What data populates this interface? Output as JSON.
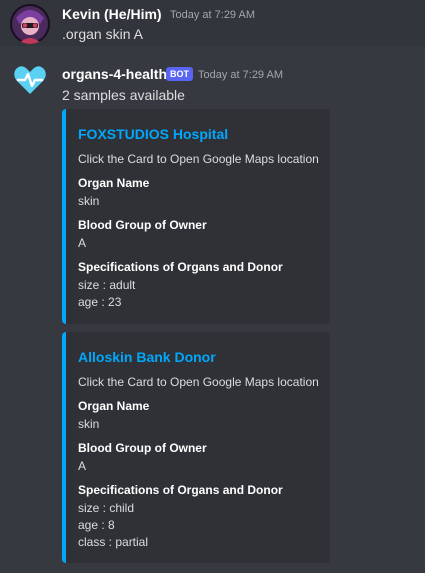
{
  "messages": [
    {
      "author": "Kevin (He/Him)",
      "timestamp": "Today at 7:29 AM",
      "content": ".organ skin A",
      "avatar_icon": "user-avatar-icon"
    },
    {
      "author": "organs-4-health",
      "badge": "BOT",
      "timestamp": "Today at 7:29 AM",
      "content": "2 samples available",
      "avatar_icon": "heart-pulse-icon",
      "embeds": [
        {
          "title": "FOXSTUDIOS Hospital",
          "description": "Click the Card to Open Google Maps location",
          "fields": [
            {
              "name": "Organ Name",
              "value": "skin"
            },
            {
              "name": "Blood Group of Owner",
              "value": "A"
            },
            {
              "name": "Specifications of Organs and Donor",
              "value_lines": [
                "size : adult",
                "age : 23"
              ]
            }
          ]
        },
        {
          "title": "Alloskin Bank Donor",
          "description": "Click the Card to Open Google Maps location",
          "fields": [
            {
              "name": "Organ Name",
              "value": "skin"
            },
            {
              "name": "Blood Group of Owner",
              "value": "A"
            },
            {
              "name": "Specifications of Organs and Donor",
              "value_lines": [
                "size : child",
                "age : 8",
                "class : partial"
              ]
            }
          ]
        }
      ]
    }
  ],
  "colors": {
    "background": "#36393f",
    "embed_background": "#2f3136",
    "embed_accent": "#00a8fc",
    "bot_badge": "#5865f2"
  }
}
